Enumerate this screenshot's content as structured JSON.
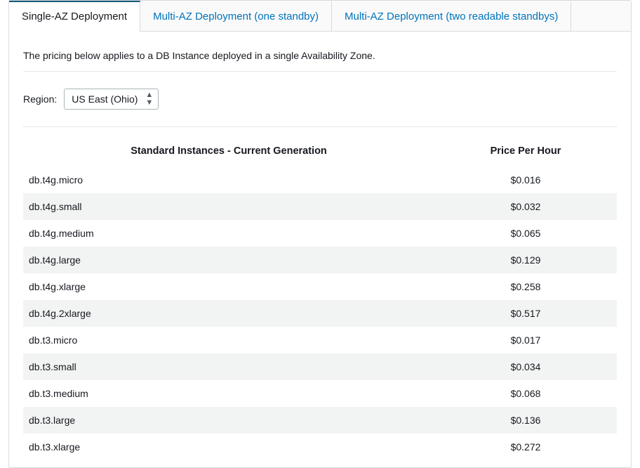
{
  "tabs": [
    {
      "label": "Single-AZ Deployment",
      "active": true
    },
    {
      "label": "Multi-AZ Deployment (one standby)",
      "active": false
    },
    {
      "label": "Multi-AZ Deployment (two readable standbys)",
      "active": false
    }
  ],
  "description": "The pricing below applies to a DB Instance deployed in a single Availability Zone.",
  "region": {
    "label": "Region:",
    "selected": "US East (Ohio)"
  },
  "table": {
    "header_instance": "Standard Instances - Current Generation",
    "header_price": "Price Per Hour",
    "rows": [
      {
        "name": "db.t4g.micro",
        "price": "$0.016"
      },
      {
        "name": "db.t4g.small",
        "price": "$0.032"
      },
      {
        "name": "db.t4g.medium",
        "price": "$0.065"
      },
      {
        "name": "db.t4g.large",
        "price": "$0.129"
      },
      {
        "name": "db.t4g.xlarge",
        "price": "$0.258"
      },
      {
        "name": "db.t4g.2xlarge",
        "price": "$0.517"
      },
      {
        "name": "db.t3.micro",
        "price": "$0.017"
      },
      {
        "name": "db.t3.small",
        "price": "$0.034"
      },
      {
        "name": "db.t3.medium",
        "price": "$0.068"
      },
      {
        "name": "db.t3.large",
        "price": "$0.136"
      },
      {
        "name": "db.t3.xlarge",
        "price": "$0.272"
      }
    ]
  }
}
